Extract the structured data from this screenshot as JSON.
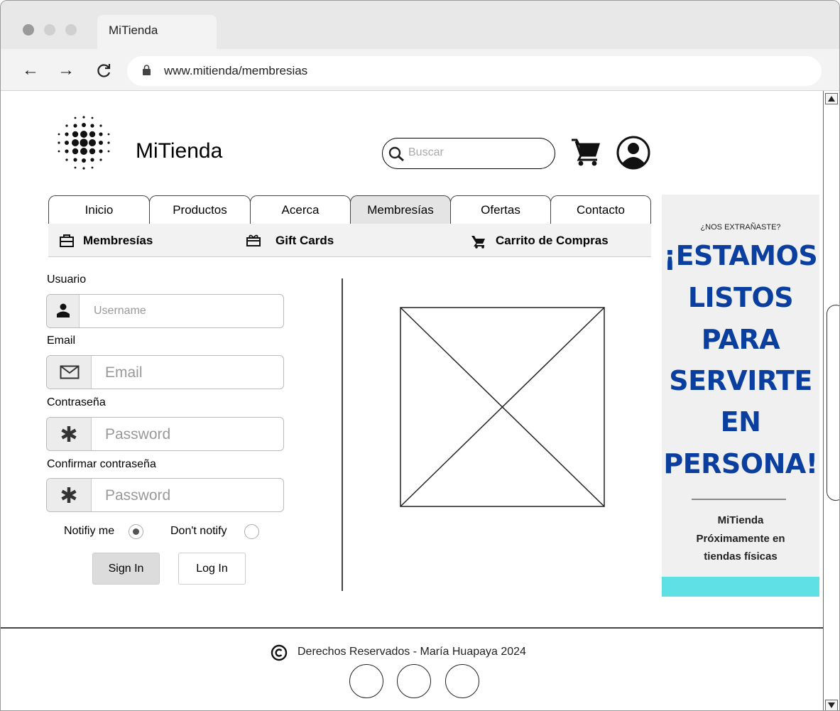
{
  "browser": {
    "tab_title": "MiTienda",
    "url": "www.mitienda/membresias"
  },
  "header": {
    "brand": "MiTienda",
    "search_placeholder": "Buscar"
  },
  "nav": {
    "tabs": [
      "Inicio",
      "Productos",
      "Acerca",
      "Membresías",
      "Ofertas",
      "Contacto"
    ],
    "active": "Membresías",
    "sub": [
      {
        "label": "Membresías",
        "icon": "briefcase-icon"
      },
      {
        "label": "Gift Cards",
        "icon": "gift-icon"
      },
      {
        "label": "Carrito de Compras",
        "icon": "cart-icon"
      }
    ]
  },
  "form": {
    "usuario_label": "Usuario",
    "usuario_placeholder": "Username",
    "email_label": "Email",
    "email_placeholder": "Email",
    "password_label": "Contraseña",
    "password_placeholder": "Password",
    "confirm_label": "Confirmar contraseña",
    "confirm_placeholder": "Password",
    "notify_label": "Notifiy me",
    "dont_notify_label": "Don't notify",
    "notify_selected": true,
    "signin_label": "Sign In",
    "login_label": "Log In"
  },
  "ad": {
    "eyebrow": "¿NOS EXTRAÑASTE?",
    "lines": [
      "¡ESTAMOS",
      "LISTOS",
      "PARA",
      "SERVIRTE",
      "EN",
      "PERSONA!"
    ],
    "brand": "MiTienda",
    "line2": "Próximamente en",
    "line3": "tiendas físicas",
    "headline_color": "#0a3fa0",
    "band_color": "#5ee0e4"
  },
  "footer": {
    "copyright": "Derechos Reservados - María Huapaya 2024"
  }
}
